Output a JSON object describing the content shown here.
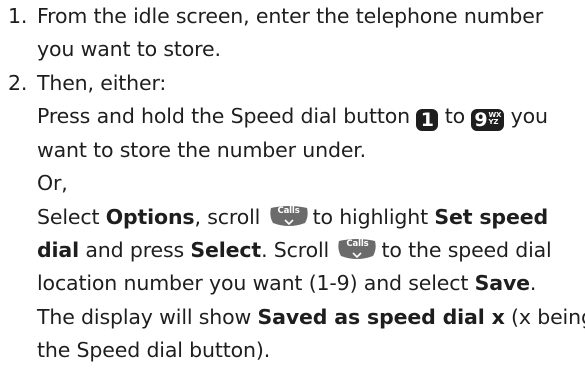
{
  "step1": {
    "number": "1.",
    "line1": "From the idle screen, enter the telephone number",
    "line2": "you want to store."
  },
  "step2": {
    "number": "2.",
    "intro": "Then, either:",
    "hold_part1": "Press and hold the Speed dial button",
    "key_from": "1",
    "to": "to",
    "key_to": "9",
    "key_to_sub": "WX\nYZ",
    "hold_part2": "you",
    "hold_line2": "want to store the number under.",
    "or": "Or,",
    "sel_select": "Select",
    "sel_options": "Options",
    "sel_scroll": ", scroll",
    "sel_nav_label": "Calls",
    "sel_to_highlight": "to highlight",
    "sel_set_speed": "Set speed",
    "sel_dial": "dial",
    "sel_and_press": "and press",
    "sel_select_btn": "Select",
    "sel_scroll2": ". Scroll",
    "sel_nav_label2": "Calls",
    "sel_to_location": "to the speed dial",
    "sel_location_line": "location number you want (1-9) and select",
    "sel_save": "Save",
    "display_pre": "The display will show",
    "display_bold": "Saved as speed dial x",
    "display_post": "(x being",
    "display_line2": "the Speed dial button)."
  }
}
